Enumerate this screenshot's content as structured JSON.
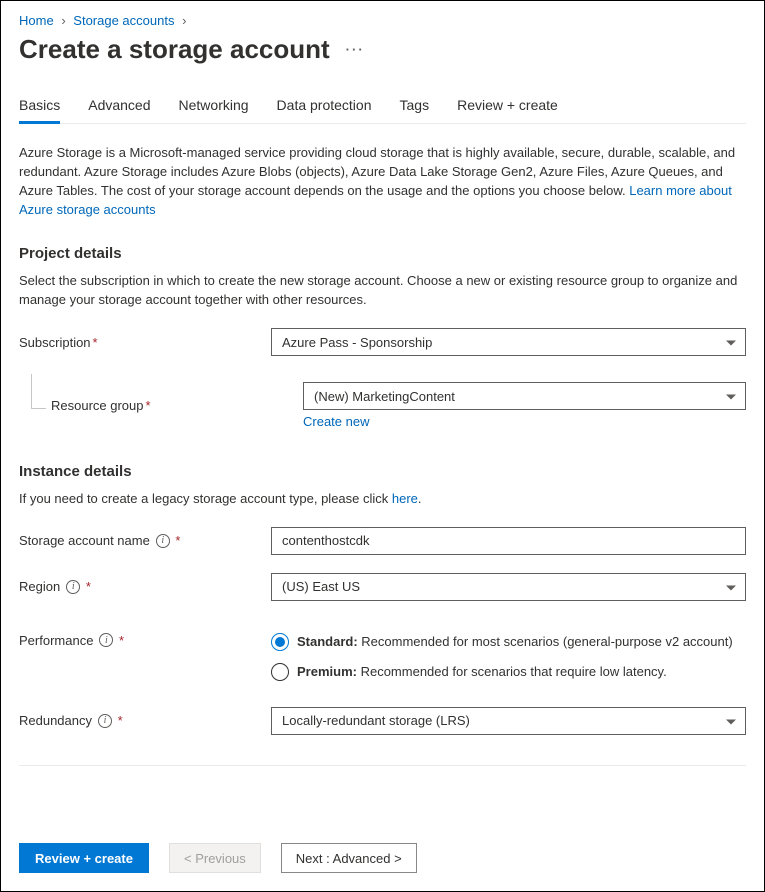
{
  "breadcrumb": {
    "home": "Home",
    "storage_accounts": "Storage accounts"
  },
  "page_title": "Create a storage account",
  "tabs": {
    "basics": "Basics",
    "advanced": "Advanced",
    "networking": "Networking",
    "data_protection": "Data protection",
    "tags": "Tags",
    "review_create": "Review + create"
  },
  "intro": {
    "text": "Azure Storage is a Microsoft-managed service providing cloud storage that is highly available, secure, durable, scalable, and redundant. Azure Storage includes Azure Blobs (objects), Azure Data Lake Storage Gen2, Azure Files, Azure Queues, and Azure Tables. The cost of your storage account depends on the usage and the options you choose below. ",
    "link": "Learn more about Azure storage accounts"
  },
  "project_details": {
    "title": "Project details",
    "desc": "Select the subscription in which to create the new storage account. Choose a new or existing resource group to organize and manage your storage account together with other resources.",
    "subscription_label": "Subscription",
    "subscription_value": "Azure Pass - Sponsorship",
    "rg_label": "Resource group",
    "rg_value": "(New) MarketingContent",
    "create_new": "Create new"
  },
  "instance_details": {
    "title": "Instance details",
    "desc_prefix": "If you need to create a legacy storage account type, please click ",
    "desc_link": "here",
    "desc_suffix": ".",
    "name_label": "Storage account name",
    "name_value": "contenthostcdk",
    "region_label": "Region",
    "region_value": "(US) East US",
    "performance_label": "Performance",
    "perf_standard_bold": "Standard:",
    "perf_standard_rest": " Recommended for most scenarios (general-purpose v2 account)",
    "perf_premium_bold": "Premium:",
    "perf_premium_rest": " Recommended for scenarios that require low latency.",
    "redundancy_label": "Redundancy",
    "redundancy_value": "Locally-redundant storage (LRS)"
  },
  "footer": {
    "review_create": "Review + create",
    "previous": "< Previous",
    "next": "Next : Advanced >"
  }
}
